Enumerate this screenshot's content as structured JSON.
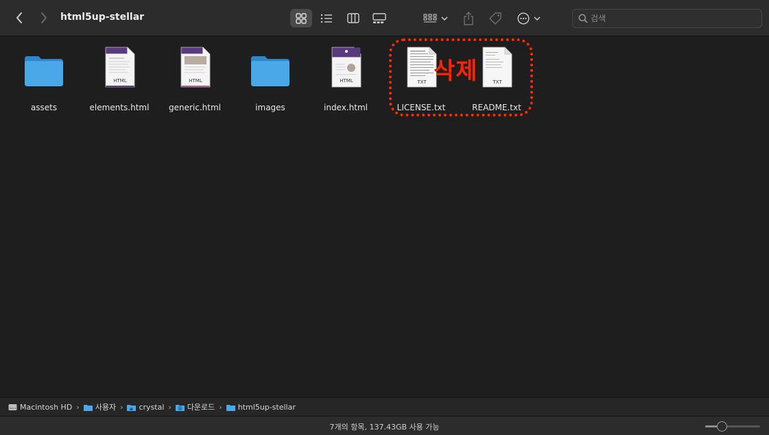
{
  "window": {
    "title": "html5up-stellar"
  },
  "toolbar": {
    "back_icon": "chevron-left-icon",
    "forward_icon": "chevron-right-icon",
    "view_modes": [
      "icon-view",
      "list-view",
      "column-view",
      "gallery-view"
    ],
    "active_view": "icon-view",
    "search_placeholder": "검색"
  },
  "items": [
    {
      "name": "assets",
      "kind": "folder"
    },
    {
      "name": "elements.html",
      "kind": "html",
      "badge": "HTML"
    },
    {
      "name": "generic.html",
      "kind": "html",
      "badge": "HTML"
    },
    {
      "name": "images",
      "kind": "folder"
    },
    {
      "name": "index.html",
      "kind": "html",
      "badge": "HTML"
    },
    {
      "name": "LICENSE.txt",
      "kind": "txt",
      "badge": "TXT"
    },
    {
      "name": "README.txt",
      "kind": "txt",
      "badge": "TXT"
    }
  ],
  "annotation": {
    "text": "삭제",
    "color": "#ff2200"
  },
  "pathbar": {
    "crumbs": [
      "Macintosh HD",
      "사용자",
      "crystal",
      "다운로드",
      "html5up-stellar"
    ]
  },
  "status": {
    "text": "7개의 항목, 137.43GB 사용 가능",
    "icon_size_level": 0.3
  },
  "colors": {
    "folder": "#4aa8e8",
    "accent": "#ff2a00",
    "html_header": "#5a3a7e"
  }
}
